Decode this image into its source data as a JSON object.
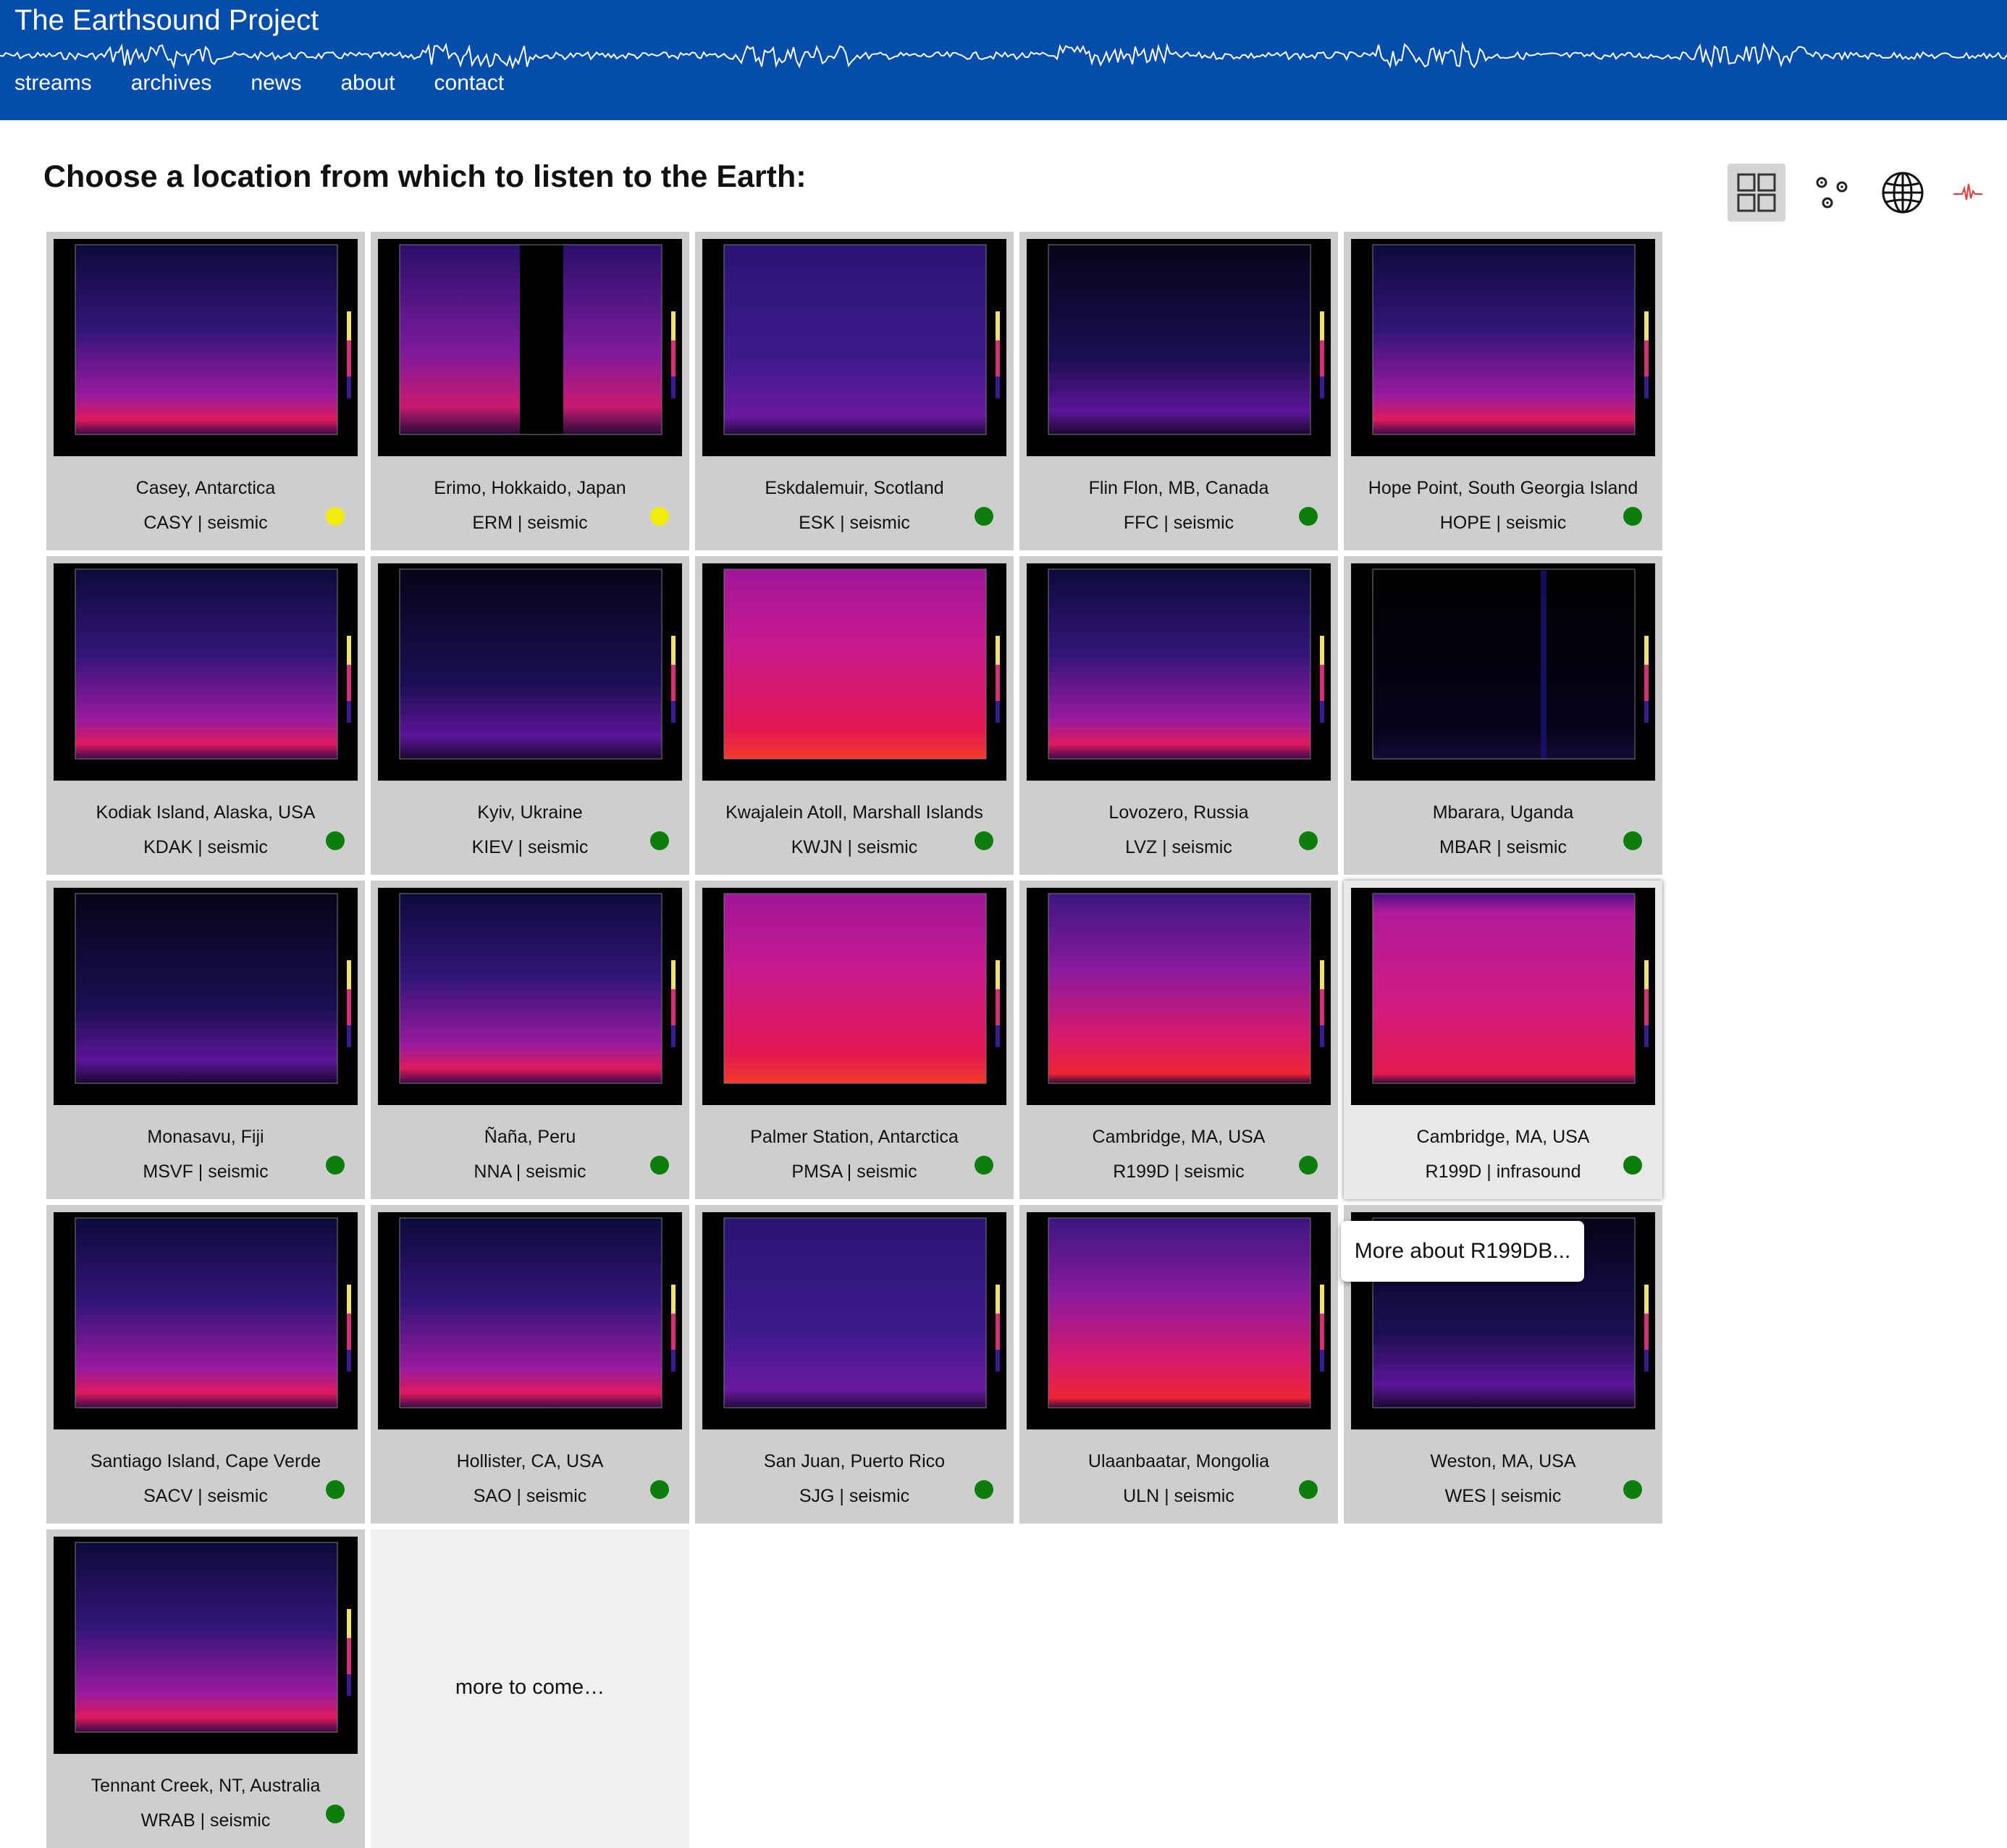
{
  "site": {
    "title": "The Earthsound Project"
  },
  "nav": [
    "streams",
    "archives",
    "news",
    "about",
    "contact"
  ],
  "heading": "Choose a location from which to listen to the Earth:",
  "view_options": [
    {
      "name": "grid-view-icon",
      "active": true
    },
    {
      "name": "cluster-view-icon",
      "active": false
    },
    {
      "name": "globe-view-icon",
      "active": false
    },
    {
      "name": "waveform-view-icon",
      "active": false
    }
  ],
  "status_colors": {
    "green": "#0b7d0b",
    "yellow": "#f1ec0c"
  },
  "stations": [
    {
      "name": "Casey, Antarctica",
      "code": "CASY | seismic",
      "status": "yellow",
      "spectro": "purple"
    },
    {
      "name": "Erimo, Hokkaido, Japan",
      "code": "ERM | seismic",
      "status": "yellow",
      "spectro": "gap"
    },
    {
      "name": "Eskdalemuir, Scotland",
      "code": "ESK | seismic",
      "status": "green",
      "spectro": "dim"
    },
    {
      "name": "Flin Flon, MB, Canada",
      "code": "FFC | seismic",
      "status": "green",
      "spectro": "dark"
    },
    {
      "name": "Hope Point, South Georgia Island",
      "code": "HOPE | seismic",
      "status": "green",
      "spectro": "purple"
    },
    {
      "name": "Kodiak Island, Alaska, USA",
      "code": "KDAK | seismic",
      "status": "green",
      "spectro": "purple"
    },
    {
      "name": "Kyiv, Ukraine",
      "code": "KIEV | seismic",
      "status": "green",
      "spectro": "dark"
    },
    {
      "name": "Kwajalein Atoll, Marshall Islands",
      "code": "KWJN | seismic",
      "status": "green",
      "spectro": "bright"
    },
    {
      "name": "Lovozero, Russia",
      "code": "LVZ | seismic",
      "status": "green",
      "spectro": "purple"
    },
    {
      "name": "Mbarara, Uganda",
      "code": "MBAR | seismic",
      "status": "green",
      "spectro": "black"
    },
    {
      "name": "Monasavu, Fiji",
      "code": "MSVF | seismic",
      "status": "green",
      "spectro": "dark"
    },
    {
      "name": "Ñaña, Peru",
      "code": "NNA | seismic",
      "status": "green",
      "spectro": "purple"
    },
    {
      "name": "Palmer Station, Antarctica",
      "code": "PMSA | seismic",
      "status": "green",
      "spectro": "bright"
    },
    {
      "name": "Cambridge, MA, USA",
      "code": "R199D | seismic",
      "status": "green",
      "spectro": "red"
    },
    {
      "name": "Cambridge, MA, USA",
      "code": "R199D | infrasound",
      "status": "green",
      "spectro": "magenta"
    },
    {
      "name": "Santiago Island, Cape Verde",
      "code": "SACV | seismic",
      "status": "green",
      "spectro": "purple"
    },
    {
      "name": "Hollister, CA, USA",
      "code": "SAO | seismic",
      "status": "green",
      "spectro": "purple"
    },
    {
      "name": "San Juan, Puerto Rico",
      "code": "SJG | seismic",
      "status": "green",
      "spectro": "dim"
    },
    {
      "name": "Ulaanbaatar, Mongolia",
      "code": "ULN | seismic",
      "status": "green",
      "spectro": "red"
    },
    {
      "name": "Weston, MA, USA",
      "code": "WES | seismic",
      "status": "green",
      "spectro": "dark"
    },
    {
      "name": "Tennant Creek, NT, Australia",
      "code": "WRAB | seismic",
      "status": "green",
      "spectro": "purple"
    }
  ],
  "more_to_come": "more to come…",
  "tooltip": "More about R199DB..."
}
